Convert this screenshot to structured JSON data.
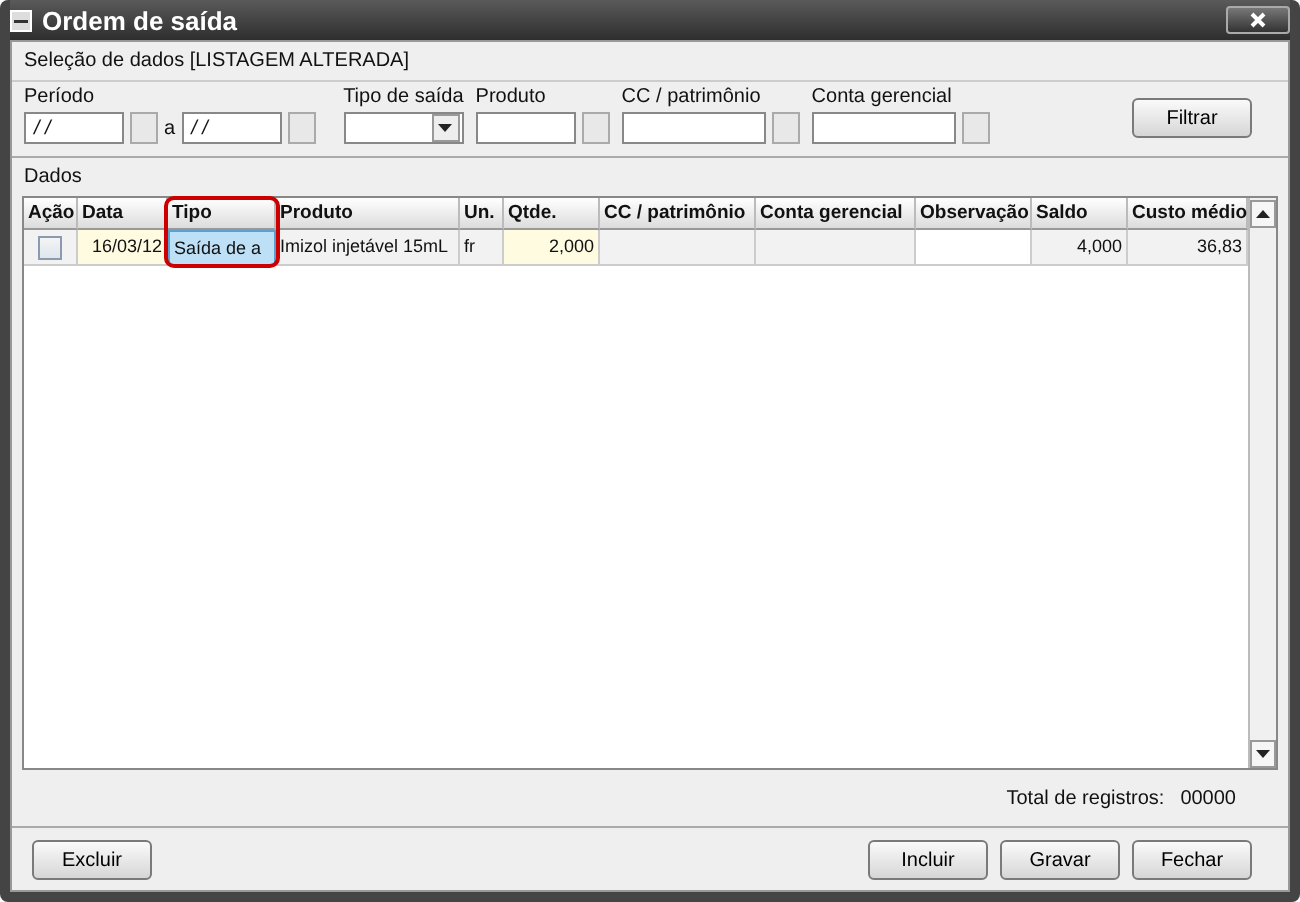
{
  "window": {
    "title": "Ordem de saída"
  },
  "filter": {
    "title": "Seleção de dados [LISTAGEM ALTERADA]",
    "period": {
      "label": "Período",
      "from": "/ /",
      "separator": "a",
      "to": "/ /"
    },
    "fields": [
      {
        "label": "Tipo de saída",
        "kind": "dropdown"
      },
      {
        "label": "Produto",
        "kind": "lookup"
      },
      {
        "label": "CC / patrimônio",
        "kind": "lookup"
      },
      {
        "label": "Conta gerencial",
        "kind": "lookup"
      }
    ],
    "button": "Filtrar"
  },
  "grid": {
    "title": "Dados",
    "columns": [
      {
        "label": "Ação",
        "kind": "check",
        "highlighted": false
      },
      {
        "label": "Data",
        "kind": "input",
        "highlighted": false
      },
      {
        "label": "Tipo",
        "kind": "text",
        "highlighted": true
      },
      {
        "label": "Produto",
        "kind": "text",
        "highlighted": false
      },
      {
        "label": "Un.",
        "kind": "text",
        "highlighted": false
      },
      {
        "label": "Qtde.",
        "kind": "input",
        "highlighted": false
      },
      {
        "label": "CC / patrimônio",
        "kind": "readonly",
        "highlighted": false
      },
      {
        "label": "Conta gerencial",
        "kind": "readonly",
        "highlighted": false
      },
      {
        "label": "Observação",
        "kind": "white",
        "highlighted": false
      },
      {
        "label": "Saldo",
        "kind": "number",
        "highlighted": false
      },
      {
        "label": "Custo médio",
        "kind": "number",
        "highlighted": false
      }
    ],
    "rows": [
      {
        "cells": [
          {
            "checked": false
          },
          {
            "text": "16/03/12",
            "selected": false
          },
          {
            "text": "Saída de a",
            "selected": true
          },
          {
            "text": "Imizol injetável 15mL",
            "selected": false
          },
          {
            "text": "fr",
            "selected": false
          },
          {
            "text": "2,000",
            "selected": false
          },
          {
            "text": "",
            "selected": false
          },
          {
            "text": "",
            "selected": false
          },
          {
            "text": "",
            "selected": false
          },
          {
            "text": "4,000",
            "selected": false
          },
          {
            "text": "36,83",
            "selected": false
          }
        ]
      }
    ]
  },
  "total": {
    "label": "Total de registros:",
    "value": "00000"
  },
  "buttons_left": [
    "Excluir"
  ],
  "buttons_right": [
    "Incluir",
    "Gravar",
    "Fechar"
  ]
}
